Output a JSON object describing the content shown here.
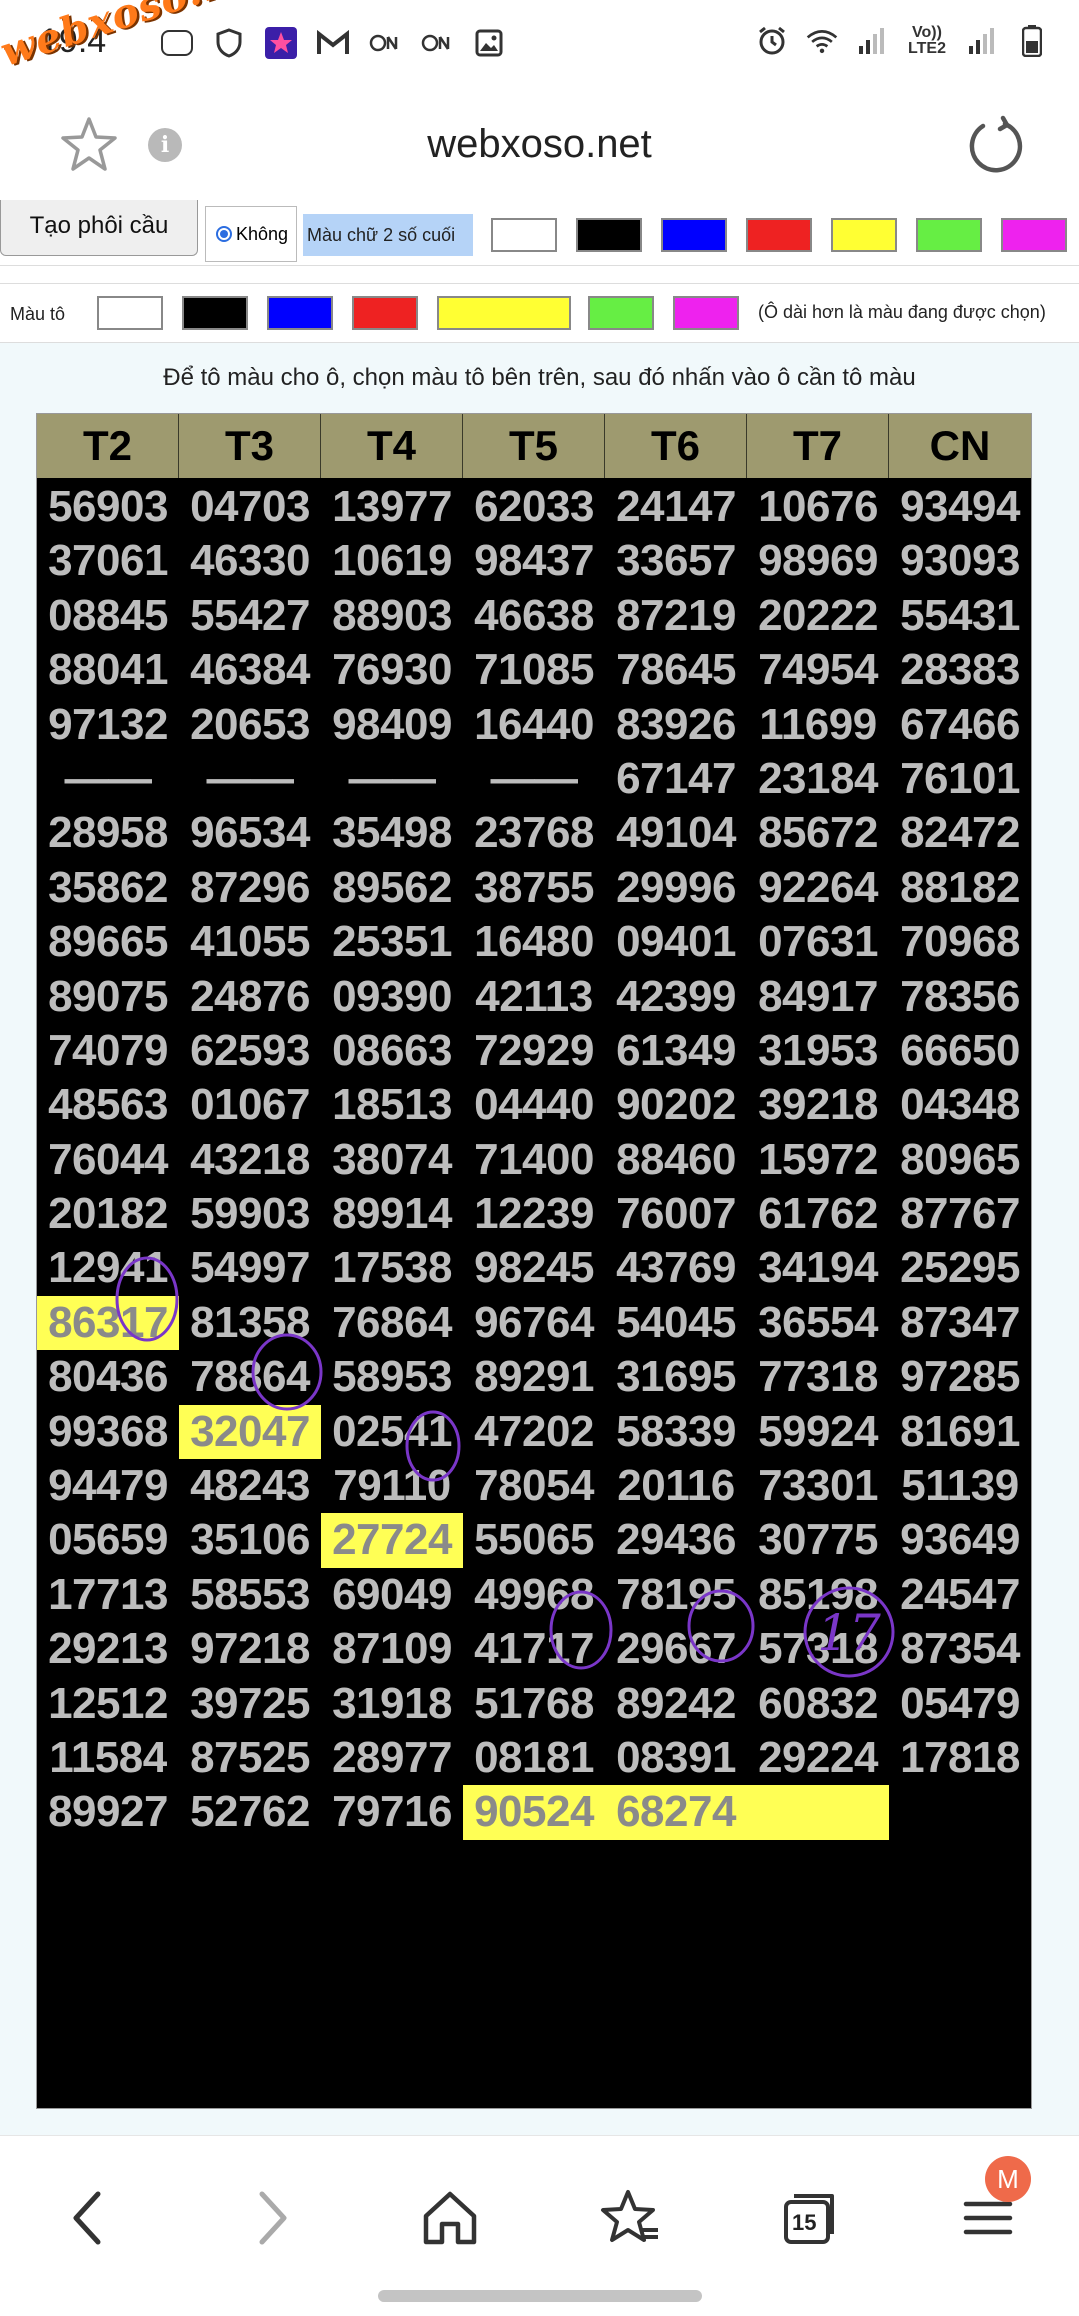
{
  "status_bar": {
    "time": "19:4",
    "watermark": "webxoso.net",
    "volte": "Vo)) LTE2",
    "left_icons": [
      "zalo-icon",
      "shield-icon",
      "star-app-icon",
      "gmail-icon",
      "nfc-icon",
      "nfc-icon",
      "gallery-icon"
    ],
    "right_icons": [
      "alarm-icon",
      "wifi-icon",
      "signal-icon",
      "battery-icon"
    ]
  },
  "address_bar": {
    "url": "webxoso.net"
  },
  "toolbar": {
    "create_button": "Tạo phôi cầu",
    "radio_label": "Không",
    "text_color_label": "Màu chữ 2 số cuối",
    "text_colors": [
      "#ffffff",
      "#000000",
      "#0000ff",
      "#ee2222",
      "#ffff33",
      "#66ee44",
      "#ee22ee"
    ],
    "fill_label": "Màu tô",
    "fill_colors": [
      "#ffffff",
      "#000000",
      "#0000ff",
      "#ee2222",
      "#ffff33",
      "#66ee44",
      "#ee22ee"
    ],
    "selected_note": "(Ô dài hơn là màu đang được chọn)"
  },
  "instruction": "Để tô màu cho ô, chọn màu tô bên trên, sau đó nhấn vào ô cần tô màu",
  "table": {
    "headers": [
      "T2",
      "T3",
      "T4",
      "T5",
      "T6",
      "T7",
      "CN"
    ],
    "rows": [
      [
        "56903",
        "04703",
        "13977",
        "62033",
        "24147",
        "10676",
        "93494"
      ],
      [
        "37061",
        "46330",
        "10619",
        "98437",
        "33657",
        "98969",
        "93093"
      ],
      [
        "08845",
        "55427",
        "88903",
        "46638",
        "87219",
        "20222",
        "55431"
      ],
      [
        "88041",
        "46384",
        "76930",
        "71085",
        "78645",
        "74954",
        "28383"
      ],
      [
        "97132",
        "20653",
        "98409",
        "16440",
        "83926",
        "11699",
        "67466"
      ],
      [
        "——",
        "——",
        "——",
        "——",
        "67147",
        "23184",
        "76101"
      ],
      [
        "28958",
        "96534",
        "35498",
        "23768",
        "49104",
        "85672",
        "82472"
      ],
      [
        "35862",
        "87296",
        "89562",
        "38755",
        "29996",
        "92264",
        "88182"
      ],
      [
        "89665",
        "41055",
        "25351",
        "16480",
        "09401",
        "07631",
        "70968"
      ],
      [
        "89075",
        "24876",
        "09390",
        "42113",
        "42399",
        "84917",
        "78356"
      ],
      [
        "74079",
        "62593",
        "08663",
        "72929",
        "61349",
        "31953",
        "66650"
      ],
      [
        "48563",
        "01067",
        "18513",
        "04440",
        "90202",
        "39218",
        "04348"
      ],
      [
        "76044",
        "43218",
        "38074",
        "71400",
        "88460",
        "15972",
        "80965"
      ],
      [
        "20182",
        "59903",
        "89914",
        "12239",
        "76007",
        "61762",
        "87767"
      ],
      [
        "12941",
        "54997",
        "17538",
        "98245",
        "43769",
        "34194",
        "25295"
      ],
      [
        "86317",
        "81358",
        "76864",
        "96764",
        "54045",
        "36554",
        "87347"
      ],
      [
        "80436",
        "78864",
        "58953",
        "89291",
        "31695",
        "77318",
        "97285"
      ],
      [
        "99368",
        "32047",
        "02541",
        "47202",
        "58339",
        "59924",
        "81691"
      ],
      [
        "94479",
        "48243",
        "79110",
        "78054",
        "20116",
        "73301",
        "51139"
      ],
      [
        "05659",
        "35106",
        "27724",
        "55065",
        "29436",
        "30775",
        "93649"
      ],
      [
        "17713",
        "58553",
        "69049",
        "49968",
        "78195",
        "85198",
        "24547"
      ],
      [
        "29213",
        "97218",
        "87109",
        "41717",
        "29667",
        "57318",
        "87354"
      ],
      [
        "12512",
        "39725",
        "31918",
        "51768",
        "89242",
        "60832",
        "05479"
      ],
      [
        "11584",
        "87525",
        "28977",
        "08181",
        "08391",
        "29224",
        "17818"
      ],
      [
        "89927",
        "52762",
        "79716",
        "90524",
        "68274",
        "",
        ""
      ]
    ],
    "highlighted": [
      [
        15,
        0
      ],
      [
        17,
        1
      ],
      [
        19,
        2
      ],
      [
        24,
        3
      ],
      [
        24,
        4
      ],
      [
        24,
        5
      ]
    ],
    "handwritten_note": "17"
  },
  "bottom_nav": {
    "tab_count": "15",
    "avatar_letter": "M"
  }
}
